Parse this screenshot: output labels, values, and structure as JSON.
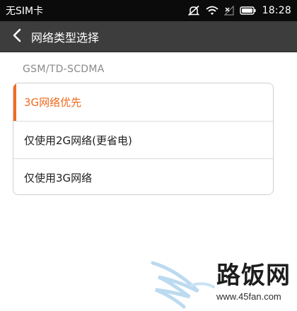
{
  "status_bar": {
    "carrier": "无SIM卡",
    "time": "18:28",
    "icons": [
      "notification-muted-icon",
      "wifi-icon",
      "no-signal-icon",
      "battery-icon"
    ]
  },
  "title_bar": {
    "back_icon": "chevron-left-icon",
    "title": "网络类型选择"
  },
  "section": {
    "header": "GSM/TD-SCDMA"
  },
  "options": [
    {
      "label": "3G网络优先",
      "selected": true
    },
    {
      "label": "仅使用2G网络(更省电)",
      "selected": false
    },
    {
      "label": "仅使用3G网络",
      "selected": false
    }
  ],
  "watermark": {
    "brand": "路饭网",
    "url": "www.45fan.com"
  },
  "colors": {
    "status_bar_bg": "#0b0b0b",
    "title_bar_bg": "#3d3d3d",
    "accent": "#f26b1d",
    "selected_text": "#ef6a1e",
    "section_header": "#8a8a8a"
  }
}
